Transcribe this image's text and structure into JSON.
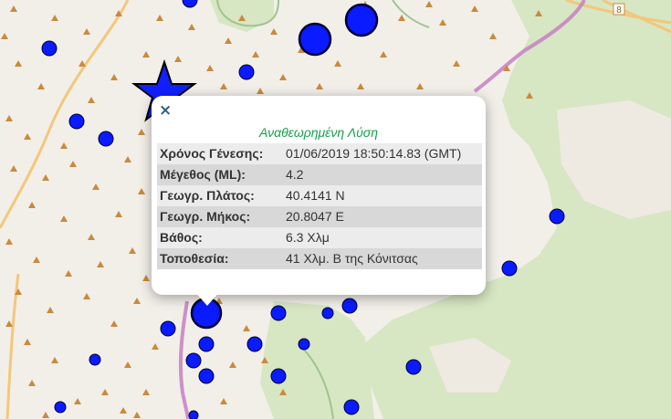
{
  "popup": {
    "close_symbol": "×",
    "title": "Αναθεωρημένη Λύση",
    "rows": [
      {
        "label": "Χρόνος Γένεσης:",
        "value": "01/06/2019 18:50:14.83 (GMT)"
      },
      {
        "label": "Μέγεθος (ML):",
        "value": "4.2"
      },
      {
        "label": "Γεωγρ. Πλάτος:",
        "value": "40.4141 N"
      },
      {
        "label": "Γεωγρ. Μήκος:",
        "value": "20.8047 E"
      },
      {
        "label": "Βάθος:",
        "value": "6.3 Χλμ"
      },
      {
        "label": "Τοποθεσία:",
        "value": "41 Χλμ. Β της Κόνιτσας"
      }
    ]
  },
  "map": {
    "road_shield": "8",
    "colors": {
      "background": "#f2efe9",
      "forest": "#d7e6c3",
      "quake_marker": "#0a1bff",
      "peak_marker": "#c98a3e",
      "border": "#c77fc4",
      "road": "#f3c77c",
      "river": "#9fc48f"
    },
    "icons": [
      "epicenter-star-icon",
      "earthquake-circle-icon",
      "peak-triangle-icon"
    ]
  }
}
